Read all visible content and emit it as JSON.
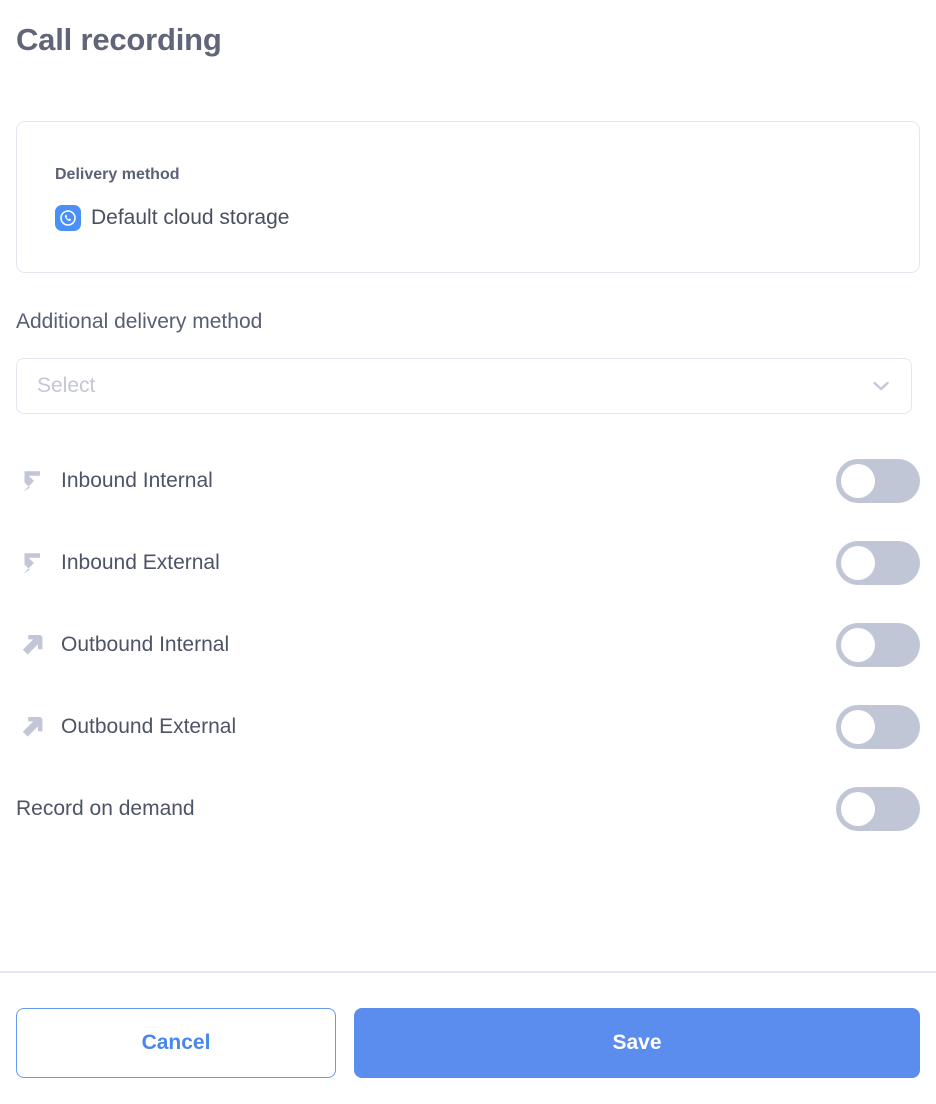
{
  "page": {
    "title": "Call recording"
  },
  "delivery_card": {
    "label": "Delivery method",
    "value": "Default cloud storage",
    "icon": "cloud-phone-icon",
    "icon_color": "#4a90f7"
  },
  "additional_delivery": {
    "label": "Additional delivery method",
    "placeholder": "Select",
    "value": "",
    "chevron_icon": "chevron-down-icon",
    "options": []
  },
  "toggle_rows": [
    {
      "id": "inbound-internal",
      "label": "Inbound Internal",
      "icon": "arrow-inbound-icon",
      "enabled": false
    },
    {
      "id": "inbound-external",
      "label": "Inbound External",
      "icon": "arrow-inbound-icon",
      "enabled": false
    },
    {
      "id": "outbound-internal",
      "label": "Outbound Internal",
      "icon": "arrow-outbound-icon",
      "enabled": false
    },
    {
      "id": "outbound-external",
      "label": "Outbound External",
      "icon": "arrow-outbound-icon",
      "enabled": false
    },
    {
      "id": "record-on-demand",
      "label": "Record on demand",
      "icon": "",
      "enabled": false
    }
  ],
  "footer": {
    "cancel_label": "Cancel",
    "save_label": "Save"
  },
  "colors": {
    "accent": "#5a8dee",
    "title_text": "#606577",
    "body_text": "#4e5467",
    "placeholder": "#c3c6d6",
    "border": "#e6e6f0",
    "toggle_off_track": "#c1c6d7",
    "icon_gray": "#c2c6d6",
    "divider": "#e4e6f1"
  }
}
